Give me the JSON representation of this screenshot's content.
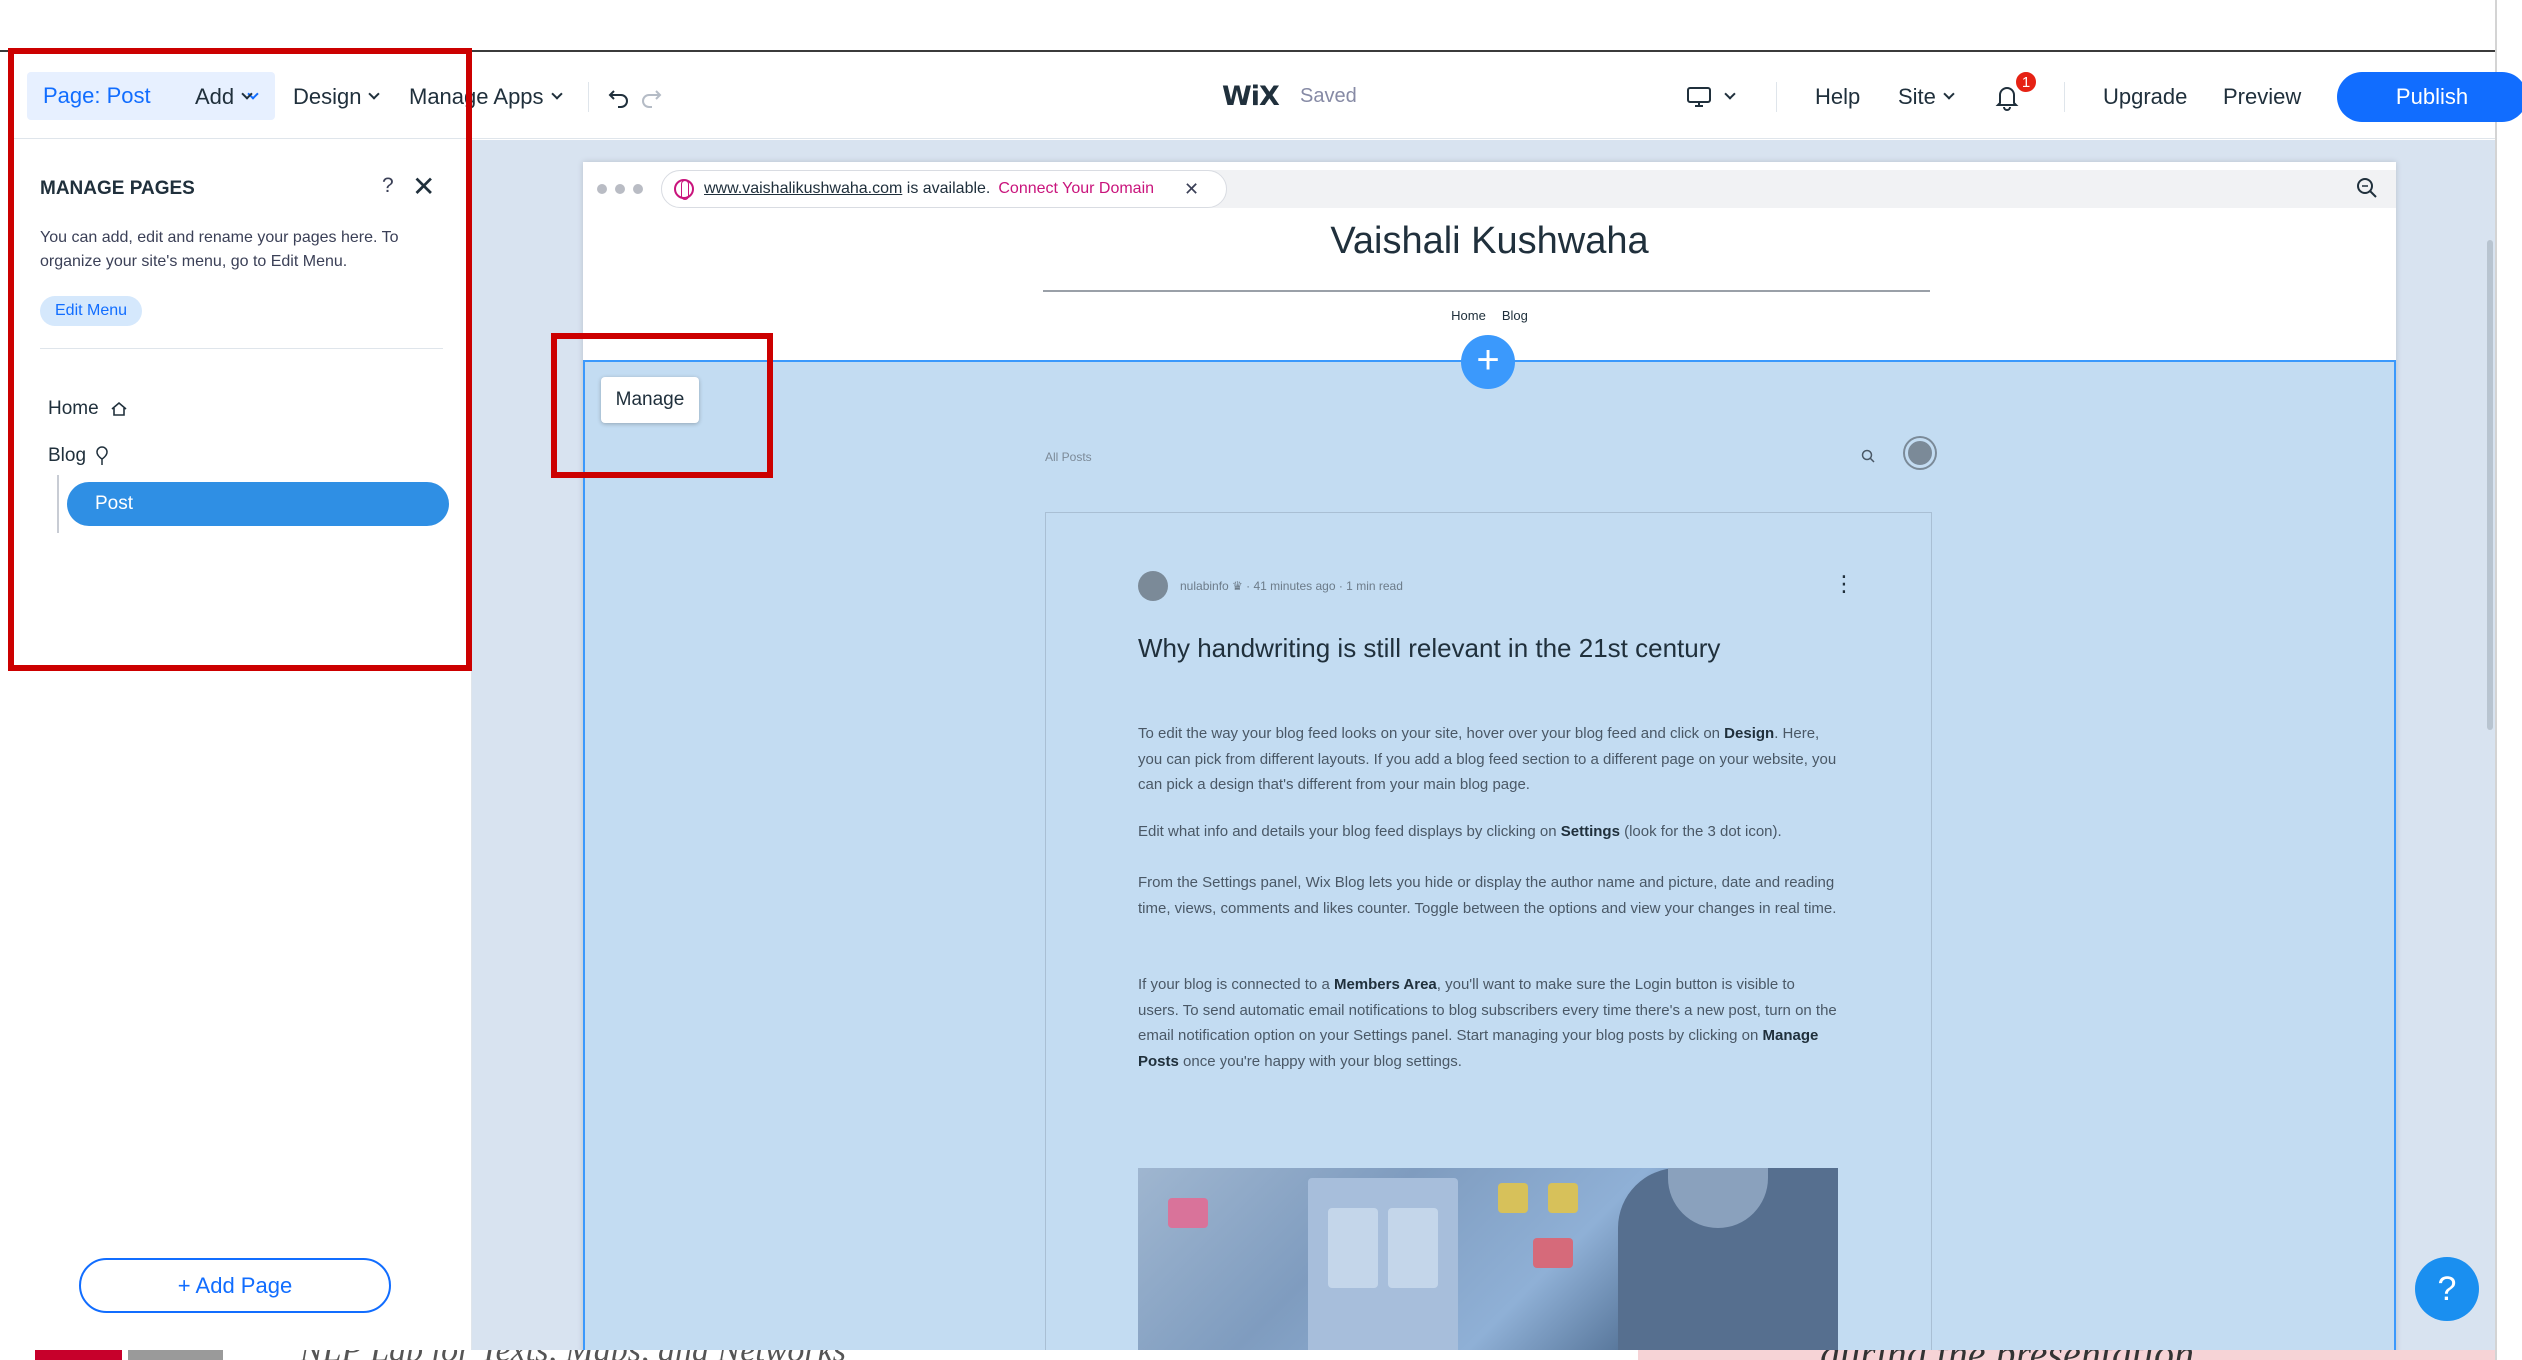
{
  "topbar": {
    "page_select": "Page: Post",
    "add": "Add",
    "design": "Design",
    "manage_apps": "Manage Apps",
    "logo": "WiX",
    "saved": "Saved",
    "help": "Help",
    "site": "Site",
    "notification_count": "1",
    "upgrade": "Upgrade",
    "preview": "Preview",
    "publish": "Publish"
  },
  "manage_pages": {
    "title": "MANAGE PAGES",
    "help": "?",
    "close": "✕",
    "description": "You can add, edit and rename your pages here. To organize your site's menu, go to Edit Menu.",
    "edit_menu": "Edit Menu",
    "pages": [
      {
        "label": "Home",
        "icon": "home-icon"
      },
      {
        "label": "Blog",
        "icon": "pin-icon"
      },
      {
        "label": "Post",
        "icon": "none",
        "selected": true
      }
    ],
    "add_page": "+ Add Page"
  },
  "browser": {
    "domain": "www.vaishalikushwaha.com",
    "available_text": " is available.",
    "connect": "Connect Your Domain",
    "close": "✕"
  },
  "site": {
    "title": "Vaishali Kushwaha",
    "nav": [
      "Home",
      "Blog"
    ],
    "manage_button": "Manage",
    "add_section": "+",
    "all_posts": "All Posts"
  },
  "post": {
    "meta": "nulabinfo ♛ · 41 minutes ago · 1 min read",
    "more": "⋮",
    "title": "Why handwriting is still relevant in the 21st century",
    "para1_a": "To edit the way your blog feed looks on your site, hover over your blog feed and click on ",
    "para1_b": "Design",
    "para1_c": ". Here, you can pick from different layouts. If you add a blog feed section to a different page on your website, you can pick a design that's different from your main blog page.",
    "para2_a": "Edit what info and details your blog feed displays by clicking on ",
    "para2_b": "Settings",
    "para2_c": " (look for the 3 dot icon).",
    "para3": "From the Settings panel, Wix Blog lets you hide or display the author name and picture, date and reading time, views, comments and likes counter. Toggle between the options and view your changes in real time.",
    "para4_a": "If your blog is connected to a ",
    "para4_b": "Members Area",
    "para4_c": ", you'll want to make sure the Login button is visible to users. To send automatic email notifications to blog subscribers every time there's a new post, turn on the email notification option on your Settings panel. Start managing your blog posts by clicking on ",
    "para4_d": "Manage Posts",
    "para4_e": " once you're happy with your blog settings."
  },
  "help_fab": "?",
  "background_bleed": {
    "left_text": "NLP Lab for Texts, Maps, and Networks",
    "right_text": "during the presentation"
  },
  "colors": {
    "accent": "#116dff",
    "annotation": "#cc0000",
    "canvas": "#d8e3f0",
    "selection": "#c3dcf2"
  }
}
